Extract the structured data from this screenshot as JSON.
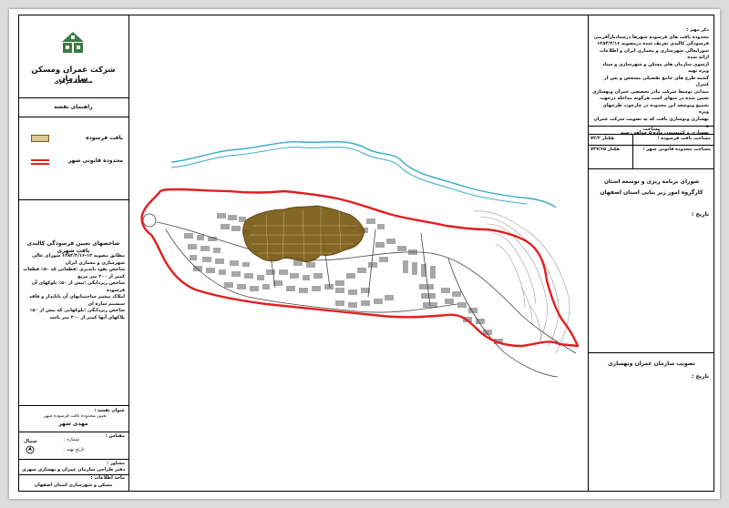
{
  "company": {
    "name": "شرکت عمران ومسکن سازمان",
    "branch": "منطقه مرکزی"
  },
  "legend": {
    "title": "راهنمای نقشه",
    "items": [
      {
        "label": "بافت فرسوده",
        "color": "#7a5a14"
      },
      {
        "label": "محدوده قانونی شهر",
        "color": "#e02020"
      }
    ]
  },
  "criteria": {
    "title": "شاخصهای تعیین فرسودگی کالبدی بافت شهری",
    "lines": [
      "مطابق مصوبه ۱۲-۱۳۸۴/۳/۱۶ شورای عالی شهرسازی و معماری ایران",
      "شاخص نفوذ ناپذیری :قطعاتی که ۵۰٪ قطعات کمتر از ۲۰۰ متر مربع",
      "شاخص ریزدانگی :بیش از ۵۰٪ بلوکهای آن فرسوده",
      "املاک بیشتر ساختمانهای آن ناپایدار و فاقد سیستم سازه ای",
      "شاخص ریزدانگی :بلوکهایی که بیش از ۵۰٪ پلاکهای آنها کمتر از ۲۰۰ متر باشد"
    ]
  },
  "title_block": {
    "project_label": "عنوان نقشه :",
    "project_line": "تعیین محدوده بافت فرسوده شهر",
    "city": "مهدی شهر",
    "scale_label": "مقیاس :",
    "no_label": "شماره :",
    "date_label": "تاریخ تهیه :",
    "north_label": "شمال",
    "consultant_label": "مشاور :",
    "consultant": "دفتر طراحی سازمان عمران و بهسازی شهری",
    "client_label": "مأخذ اطلاعات :",
    "client": "مسکن و شهرسازی استان اصفهان"
  },
  "notes": {
    "heading": "ذکر مهم :",
    "lines": [
      "محدوده بافت های فرسوده شهرها درستادبازآفرینی",
      "فرسودگی کالبدی تعریف شده درمصوبه ۱۳۸۴/۳/۱۶",
      "شورایعالی شهرسازی و معماری ایران و اطلاعات ارائه شده",
      "ازسوی سازمان های مسکن و شهرسازی و ستاد ویژه تهیه",
      "گشته طرح های جامع تفصیلی مشخص و پس از کنترل",
      "میدانی توسط شرکت مادر تخصصی عمران وبهسازی",
      "تعیین شده در  منهای است  هرگونه مداخله  درجهت",
      "تجمیع وتوسعه این محدوده  در چارچوب طرحهای ویژه",
      "بهسازی ونوسازی بافت که به تصویب  شرکت عمران و",
      "بهسازی و کمیسیون ماده ۵ خواهد رسید"
    ],
    "area_title": "مساحت",
    "area_rows": [
      {
        "label": "مساحت بافت فرسوده :",
        "value": "۷۲/۲",
        "unit": "هکتار"
      },
      {
        "label": "مساحت محدوده قانونی شهر :",
        "value": "۷۴۷/۶۵",
        "unit": "هکتار"
      }
    ]
  },
  "approval": {
    "line1": "شورای برنامه ریزی و توسعه استان",
    "line2": "کارگروه امور زیر بنایی استان اصفهان",
    "date_label": "تاریخ :"
  },
  "ratify": {
    "line1": "تصویب سازمان عمران وبهسازی",
    "date_label": "تاریخ :"
  },
  "colors": {
    "boundary": "#e02020",
    "river": "#39a9c8",
    "worn": "#7a5a14",
    "block": "#6a6a6a"
  }
}
